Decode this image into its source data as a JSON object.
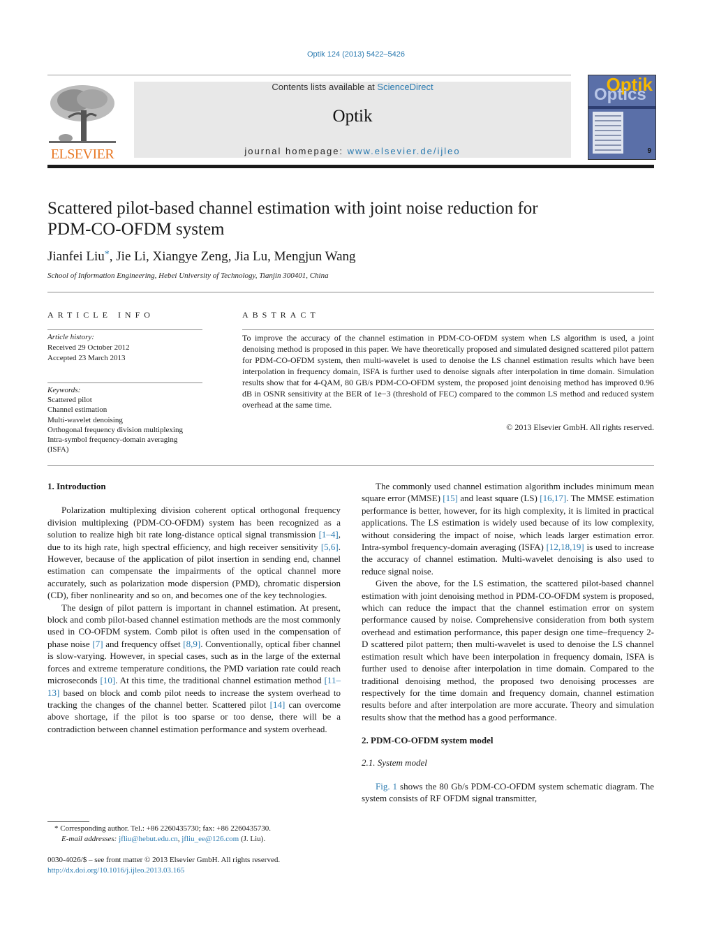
{
  "header": {
    "citation": "Optik 124 (2013) 5422–5426",
    "contents_prefix": "Contents lists available at ",
    "contents_link": "ScienceDirect",
    "journal_name": "Optik",
    "homepage_prefix": "journal homepage: ",
    "homepage_link": "www.elsevier.de/ijleo",
    "publisher_logo": "ELSEVIER",
    "cover": {
      "title_top": "Optik",
      "title_bottom": "Optics",
      "issue": "9"
    }
  },
  "colors": {
    "link": "#2a7ab0",
    "elsevier_orange": "#e87722",
    "banner_bg": "#e8e8e8"
  },
  "article": {
    "title_line1": "Scattered pilot-based channel estimation with joint noise reduction for",
    "title_line2": "PDM-CO-OFDM system",
    "authors": [
      {
        "name": "Jianfei Liu",
        "mark": "*"
      },
      {
        "name": "Jie Li"
      },
      {
        "name": "Xiangye Zeng"
      },
      {
        "name": "Jia Lu"
      },
      {
        "name": "Mengjun Wang"
      }
    ],
    "affiliation": "School of Information Engineering, Hebei University of Technology, Tianjin 300401, China"
  },
  "article_info": {
    "heading": "ARTICLE INFO",
    "history_label": "Article history:",
    "received": "Received 29 October 2012",
    "accepted": "Accepted 23 March 2013",
    "keywords_label": "Keywords:",
    "keywords": [
      "Scattered pilot",
      "Channel estimation",
      "Multi-wavelet denoising",
      "Orthogonal frequency division multiplexing",
      "Intra-symbol frequency-domain averaging",
      "(ISFA)"
    ]
  },
  "abstract": {
    "heading": "ABSTRACT",
    "text": "To improve the accuracy of the channel estimation in PDM-CO-OFDM system when LS algorithm is used, a joint denoising method is proposed in this paper. We have theoretically proposed and simulated designed scattered pilot pattern for PDM-CO-OFDM system, then multi-wavelet is used to denoise the LS channel estimation results which have been interpolation in frequency domain, ISFA is further used to denoise signals after interpolation in time domain. Simulation results show that for 4-QAM, 80 GB/s PDM-CO-OFDM system, the proposed joint denoising method has improved 0.96 dB in OSNR sensitivity at the BER of 1e−3 (threshold of FEC) compared to the common LS method and reduced system overhead at the same time.",
    "copyright": "© 2013 Elsevier GmbH. All rights reserved."
  },
  "body": {
    "sec1_heading": "1.  Introduction",
    "p1": [
      "Polarization multiplexing division coherent optical orthogonal frequency division multiplexing (PDM-CO-OFDM) system has been recognized as a solution to realize high bit rate long-distance optical signal transmission ",
      "[1–4]",
      ", due to its high rate, high spectral efficiency, and high receiver sensitivity ",
      "[5,6]",
      ". However, because of the application of pilot insertion in sending end, channel estimation can compensate the impairments of the optical channel more accurately, such as polarization mode dispersion (PMD), chromatic dispersion (CD), fiber nonlinearity and so on, and becomes one of the key technologies."
    ],
    "p2": [
      "The design of pilot pattern is important in channel estimation. At present, block and comb pilot-based channel estimation methods are the most commonly used in CO-OFDM system. Comb pilot is often used in the compensation of phase noise ",
      "[7]",
      " and frequency offset ",
      "[8,9]",
      ". Conventionally, optical fiber channel is slow-varying. However, in special cases, such as in the large of the external forces and extreme temperature conditions, the PMD variation rate could reach microseconds ",
      "[10]",
      ". At this time, the traditional channel estimation method ",
      "[11–13]",
      " based on block and comb pilot needs to increase the system overhead to tracking the changes of the channel better. Scattered pilot ",
      "[14]",
      " can overcome above shortage, if the pilot is too sparse or too dense, there will be a contradiction between channel estimation performance and system overhead."
    ],
    "p3": [
      "The commonly used channel estimation algorithm includes minimum mean square error (MMSE) ",
      "[15]",
      " and least square (LS) ",
      "[16,17]",
      ". The MMSE estimation performance is better, however, for its high complexity, it is limited in practical applications. The LS estimation is widely used because of its low complexity, without considering the impact of noise, which leads larger estimation error. Intra-symbol frequency-domain averaging (ISFA) ",
      "[12,18,19]",
      " is used to increase the accuracy of channel estimation. Multi-wavelet denoising is also used to reduce signal noise."
    ],
    "p4": "Given the above, for the LS estimation, the scattered pilot-based channel estimation with joint denoising method in PDM-CO-OFDM system is proposed, which can reduce the impact that the channel estimation error on system performance caused by noise. Comprehensive consideration from both system overhead and estimation performance, this paper design one time–frequency 2-D scattered pilot pattern; then multi-wavelet is used to denoise the LS channel estimation result which have been interpolation in frequency domain, ISFA is further used to denoise after interpolation in time domain. Compared to the traditional denoising method, the proposed two denoising processes are respectively for the time domain and frequency domain, channel estimation results before and after interpolation are more accurate. Theory and simulation results show that the method has a good performance.",
    "sec2_heading": "2.  PDM-CO-OFDM system model",
    "sec21_heading": "2.1.  System model",
    "p5": [
      "Fig. 1",
      " shows the 80 Gb/s PDM-CO-OFDM system schematic diagram. The system consists of RF OFDM signal transmitter,"
    ]
  },
  "footnote": {
    "mark": "*",
    "corresponding": "Corresponding author. Tel.: +86 2260435730; fax: +86 2260435730.",
    "email_label": "E-mail addresses:",
    "email1": "jfliu@hebut.edu.cn",
    "sep": ", ",
    "email2": "jfliu_ee@126.com",
    "email_suffix": " (J. Liu)."
  },
  "front_matter": {
    "issn": "0030-4026/$ – see front matter © 2013 Elsevier GmbH. All rights reserved.",
    "doi": "http://dx.doi.org/10.1016/j.ijleo.2013.03.165"
  }
}
